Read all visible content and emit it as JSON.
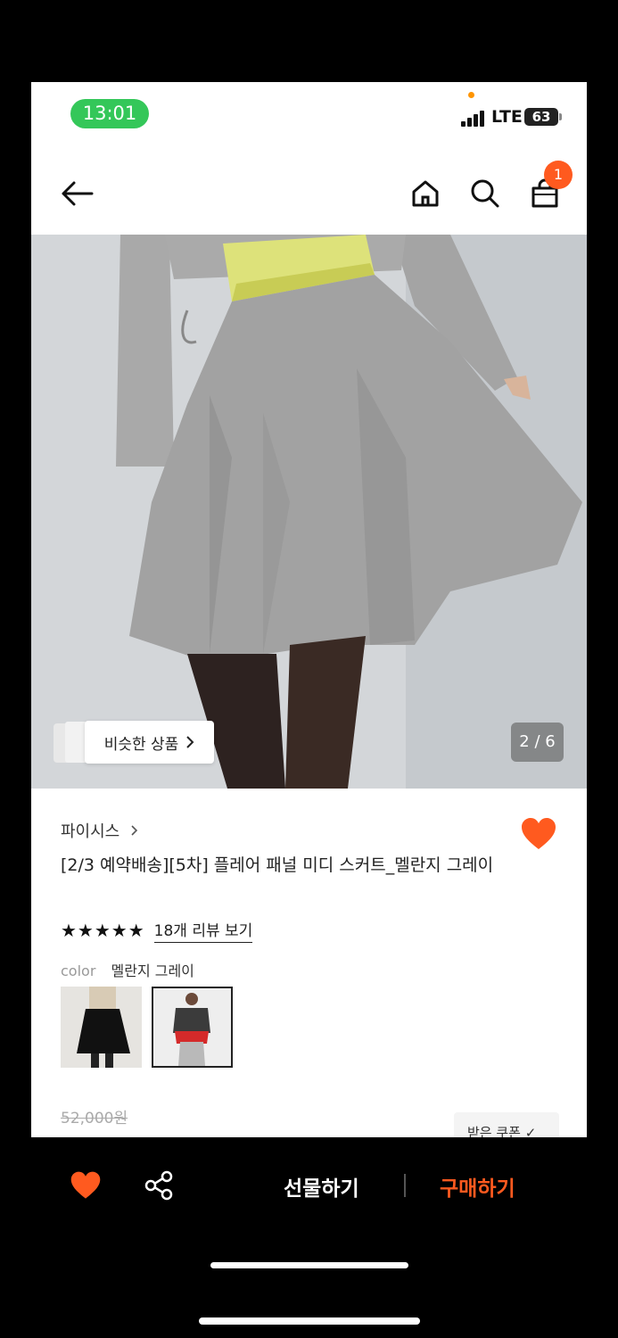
{
  "status": {
    "time": "13:01",
    "network": "LTE",
    "battery": "63"
  },
  "nav": {
    "cart_count": "1"
  },
  "gallery": {
    "similar_label": "비슷한 상품",
    "page_counter": "2 / 6"
  },
  "product": {
    "brand": "파이시스",
    "title": "[2/3 예약배송][5차] 플레어 패널 미디 스커트_멜란지 그레이",
    "rating_stars": "★★★★★",
    "review_link": "18개 리뷰 보기",
    "color_label": "color",
    "color_value": "멜란지 그레이",
    "original_price": "52,000원",
    "coupon_label": "받은 쿠폰 ✓"
  },
  "bottom_bar": {
    "gift_label": "선물하기",
    "buy_label": "구매하기"
  },
  "colors": {
    "accent": "#ff5a1f",
    "status_green": "#34c759"
  }
}
